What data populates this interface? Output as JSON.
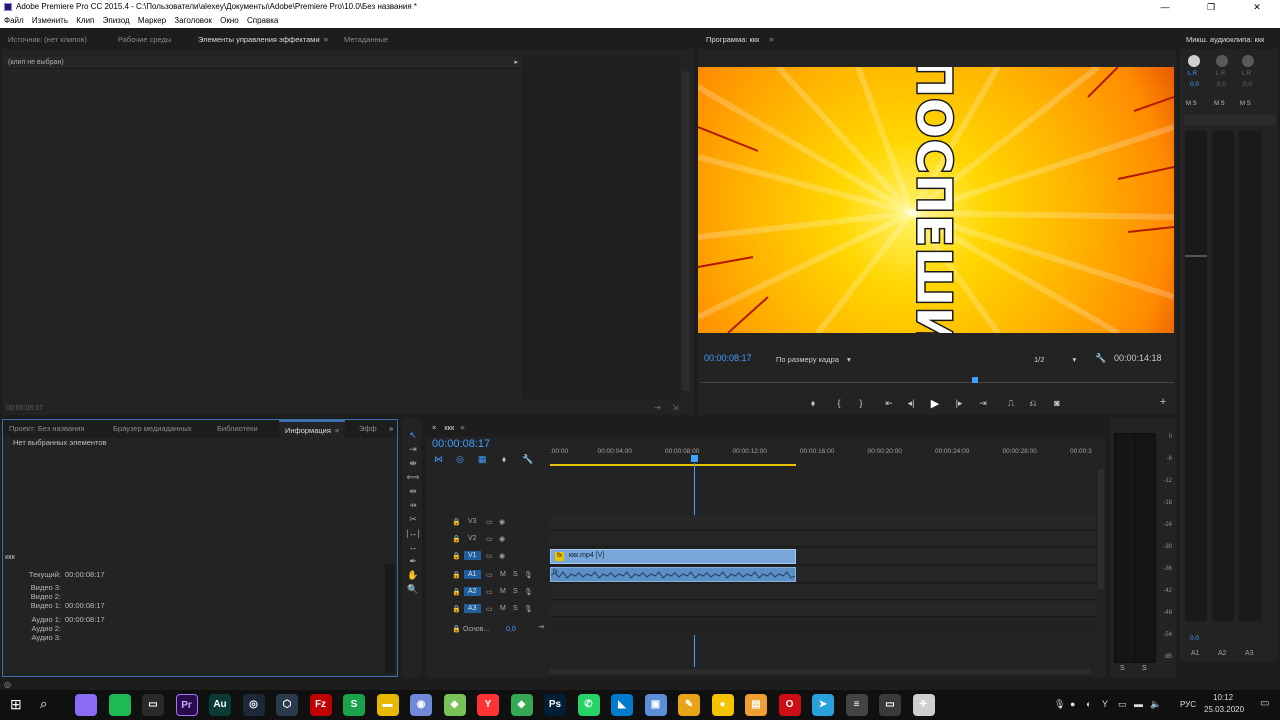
{
  "window": {
    "title": "Adobe Premiere Pro CC 2015.4 - C:\\Пользователи\\alexey\\Документы\\Adobe\\Premiere Pro\\10.0\\Без названия *"
  },
  "menu": [
    "Файл",
    "Изменить",
    "Клип",
    "Эпизод",
    "Маркер",
    "Заголовок",
    "Окно",
    "Справка"
  ],
  "source_panel": {
    "tabs": [
      "Источник: (нет клипов)",
      "Рабочие среды",
      "Элементы управления эффектами",
      "Метаданные"
    ],
    "active_tab_menu": "≡",
    "clip_status": "(клип не выбран)",
    "timecode": "00:00:08:17"
  },
  "program_panel": {
    "title": "Программа: ккк",
    "title_menu": "≡",
    "frame_text": "ПОСПЕШИ",
    "current_timecode": "00:00:08:17",
    "fit": "По размеру кадра",
    "resolution": "1/2",
    "duration": "00:00:14:18",
    "playhead_fraction": 0.58
  },
  "audio_mixer": {
    "title": "Микш. аудиоклипа: ккк",
    "channels": [
      {
        "lr": "L R",
        "value": "0,0",
        "ms": "M S",
        "label": "A1"
      },
      {
        "lr": "L R",
        "value": "0,0",
        "ms": "M S",
        "label": "A2"
      },
      {
        "lr": "L R",
        "value": "0,0",
        "ms": "M S",
        "label": "A3"
      }
    ],
    "fader_value": "0,0"
  },
  "project_panel": {
    "tabs": [
      "Проект: Без названия",
      "Браузер медиаданных",
      "Библиотеки",
      "Информация",
      "Эфф"
    ],
    "active_tab_menu": "≡",
    "overflow": "»",
    "empty_text": "Нет выбранных элементов",
    "sequence_name": "ккк",
    "rows": [
      {
        "label": "Текущий:",
        "value": "00:00:08:17"
      },
      {
        "label": "Видео 3:",
        "value": ""
      },
      {
        "label": "Видео 2:",
        "value": ""
      },
      {
        "label": "Видео 1:",
        "value": "00:00:08:17"
      },
      {
        "label": "Аудио 1:",
        "value": "00:00:08:17"
      },
      {
        "label": "Аудио 2:",
        "value": ""
      },
      {
        "label": "Аудио 3:",
        "value": ""
      }
    ]
  },
  "timeline": {
    "tab_close": "×",
    "sequence": "ккк",
    "tab_menu": "≡",
    "timecode": "00:00:08:17",
    "ruler": [
      ":00:00",
      "00:00:04:00",
      "00:00:08:00",
      "00:00:12:00",
      "00:00:16:00",
      "00:00:20:00",
      "00:00:24:00",
      "00:00:28:00",
      "00:00:3"
    ],
    "video_tracks": [
      "V3",
      "V2",
      "V1"
    ],
    "audio_tracks": [
      "A1",
      "A2",
      "A3"
    ],
    "ms": [
      "M",
      "S"
    ],
    "master_label": "Основ...",
    "master_value": "0,0",
    "video_clip": "ккк.mp4 [V]",
    "audio_clip_badge": "fx"
  },
  "meters": {
    "scale": [
      "0",
      "-6",
      "-12",
      "-18",
      "-24",
      "-30",
      "-36",
      "-42",
      "-48",
      "-54",
      "dB"
    ],
    "solo_labels": [
      "S",
      "S"
    ]
  },
  "taskbar": {
    "time": "10:12",
    "date": "25.03.2020",
    "lang": "РУС",
    "apps": [
      {
        "name": "cortana",
        "glyph": "",
        "color": "#8b6cf5"
      },
      {
        "name": "spotify",
        "glyph": "",
        "color": "#1db954"
      },
      {
        "name": "terminal",
        "glyph": "▭",
        "color": "#2a2a2a"
      },
      {
        "name": "premiere",
        "glyph": "Pr",
        "color": "#2a0a4a"
      },
      {
        "name": "audition",
        "glyph": "Au",
        "color": "#0a3a34"
      },
      {
        "name": "steam",
        "glyph": "◎",
        "color": "#1b2838"
      },
      {
        "name": "3d-box",
        "glyph": "⬡",
        "color": "#2b3a4a"
      },
      {
        "name": "filezilla",
        "glyph": "Fz",
        "color": "#bf0000"
      },
      {
        "name": "skype-s",
        "glyph": "S",
        "color": "#1aa34a"
      },
      {
        "name": "explorer",
        "glyph": "▬",
        "color": "#e6b800"
      },
      {
        "name": "discord",
        "glyph": "◉",
        "color": "#7289da"
      },
      {
        "name": "android",
        "glyph": "◆",
        "color": "#78c257"
      },
      {
        "name": "yandex",
        "glyph": "Y",
        "color": "#ff3333"
      },
      {
        "name": "maps",
        "glyph": "◈",
        "color": "#34a853"
      },
      {
        "name": "photoshop",
        "glyph": "Ps",
        "color": "#001e36"
      },
      {
        "name": "whatsapp",
        "glyph": "✆",
        "color": "#25d366"
      },
      {
        "name": "vscode",
        "glyph": "◣",
        "color": "#007acc"
      },
      {
        "name": "photos",
        "glyph": "▣",
        "color": "#5a8fd8"
      },
      {
        "name": "pen",
        "glyph": "✎",
        "color": "#e8a317"
      },
      {
        "name": "yellow-app",
        "glyph": "●",
        "color": "#f5c400"
      },
      {
        "name": "files",
        "glyph": "▤",
        "color": "#f0a030"
      },
      {
        "name": "opera",
        "glyph": "O",
        "color": "#cc0f16"
      },
      {
        "name": "telegram",
        "glyph": "➤",
        "color": "#2aa1da"
      },
      {
        "name": "notes",
        "glyph": "≡",
        "color": "#444"
      },
      {
        "name": "desktop",
        "glyph": "▭",
        "color": "#3a3a3a"
      },
      {
        "name": "tool",
        "glyph": "✈",
        "color": "#cfcfcf"
      }
    ]
  }
}
